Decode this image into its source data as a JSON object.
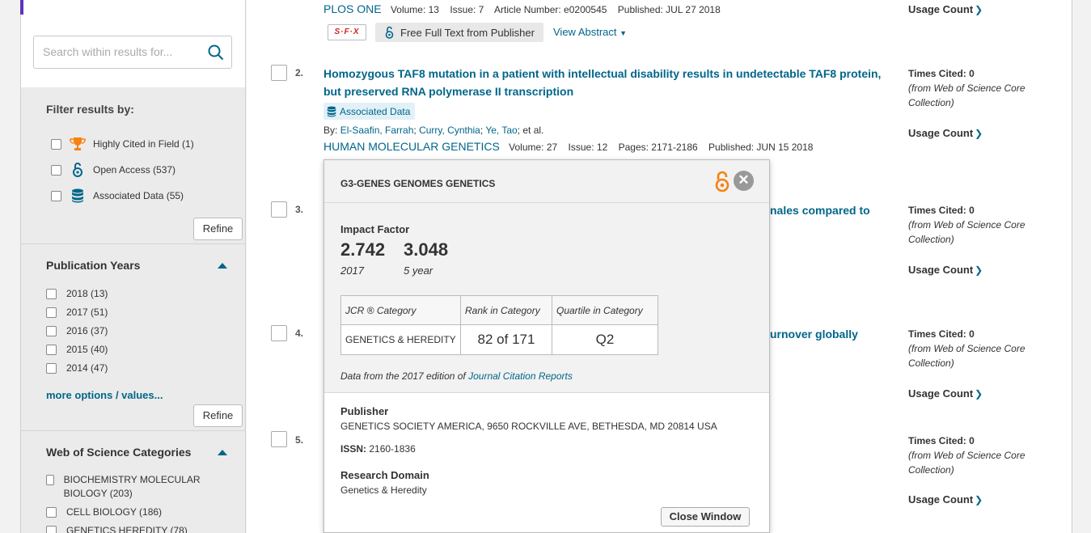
{
  "search": {
    "placeholder": "Search within results for..."
  },
  "filters": {
    "title": "Filter results by:",
    "items": [
      {
        "label": "Highly Cited in Field (1)",
        "icon": "trophy-icon"
      },
      {
        "label": "Open Access (537)",
        "icon": "open-access-icon"
      },
      {
        "label": "Associated Data (55)",
        "icon": "database-icon"
      }
    ],
    "refine_label": "Refine"
  },
  "pub_years": {
    "title": "Publication Years",
    "items": [
      "2018 (13)",
      "2017 (51)",
      "2016 (37)",
      "2015 (40)",
      "2014 (47)"
    ],
    "more_link": "more options / values...",
    "refine_label": "Refine"
  },
  "wos_categories": {
    "title": "Web of Science Categories",
    "items": [
      "BIOCHEMISTRY MOLECULAR BIOLOGY (203)",
      "CELL BIOLOGY (186)",
      "GENETICS HEREDITY (78)"
    ]
  },
  "record1": {
    "journal": "PLOS ONE",
    "volume": "Volume: 13",
    "issue": "Issue: 7",
    "article": "Article Number: e0200545",
    "published": "Published: JUL 27 2018",
    "sfx_label": "S·F·X",
    "fft_label": "Free Full Text from Publisher",
    "view_abstract": "View Abstract",
    "usage": "Usage Count"
  },
  "record2": {
    "num": "2.",
    "title": "Homozygous TAF8 mutation in a patient with intellectual disability results in undetectable TAF8 protein, but preserved RNA polymerase II transcription",
    "badge": "Associated Data",
    "by": "By:",
    "authors": "El-Saafin, Farrah",
    "author2": "Curry, Cynthia",
    "author3": "Ye, Tao",
    "etal": "; et al.",
    "journal": "HUMAN MOLECULAR GENETICS",
    "volume": "Volume: 27",
    "issue": "Issue: 12",
    "pages": "Pages: 2171-2186",
    "published": "Published: JUN 15 2018",
    "cited_label": "Times Cited: 0",
    "cited_note": "(from Web of Science Core Collection)",
    "usage": "Usage Count"
  },
  "record3": {
    "num": "3.",
    "title_fragment": "nales compared to",
    "cited_label": "Times Cited: 0",
    "cited_note": "(from Web of Science Core Collection)",
    "usage": "Usage Count"
  },
  "record4": {
    "num": "4.",
    "title_fragment": "urnover globally",
    "cited_label": "Times Cited: 0",
    "cited_note": "(from Web of Science Core Collection)",
    "usage": "Usage Count"
  },
  "record5": {
    "num": "5.",
    "cited_label": "Times Cited: 0",
    "cited_note": "(from Web of Science Core Collection)",
    "usage": "Usage Count"
  },
  "popup": {
    "journal": "G3-GENES GENOMES GENETICS",
    "impact_factor_label": "Impact Factor",
    "if_2017": "2.742",
    "if_2017_label": "2017",
    "if_5yr": "3.048",
    "if_5yr_label": "5 year",
    "table_headers": [
      "JCR ® Category",
      "Rank in Category",
      "Quartile in Category"
    ],
    "table_row": [
      "GENETICS & HEREDITY",
      "82 of 171",
      "Q2"
    ],
    "data_from": "Data from the 2017 edition of ",
    "data_from_link": "Journal Citation Reports",
    "publisher_label": "Publisher",
    "publisher": "GENETICS SOCIETY AMERICA, 9650 ROCKVILLE AVE, BETHESDA, MD 20814 USA",
    "issn_label": "ISSN:",
    "issn": "2160-1836",
    "domain_label": "Research Domain",
    "domain": "Genetics & Heredity",
    "close_label": "Close Window"
  },
  "colors": {
    "link": "#00668a",
    "accent": "#5e33bf",
    "open_access": "#f68212"
  }
}
